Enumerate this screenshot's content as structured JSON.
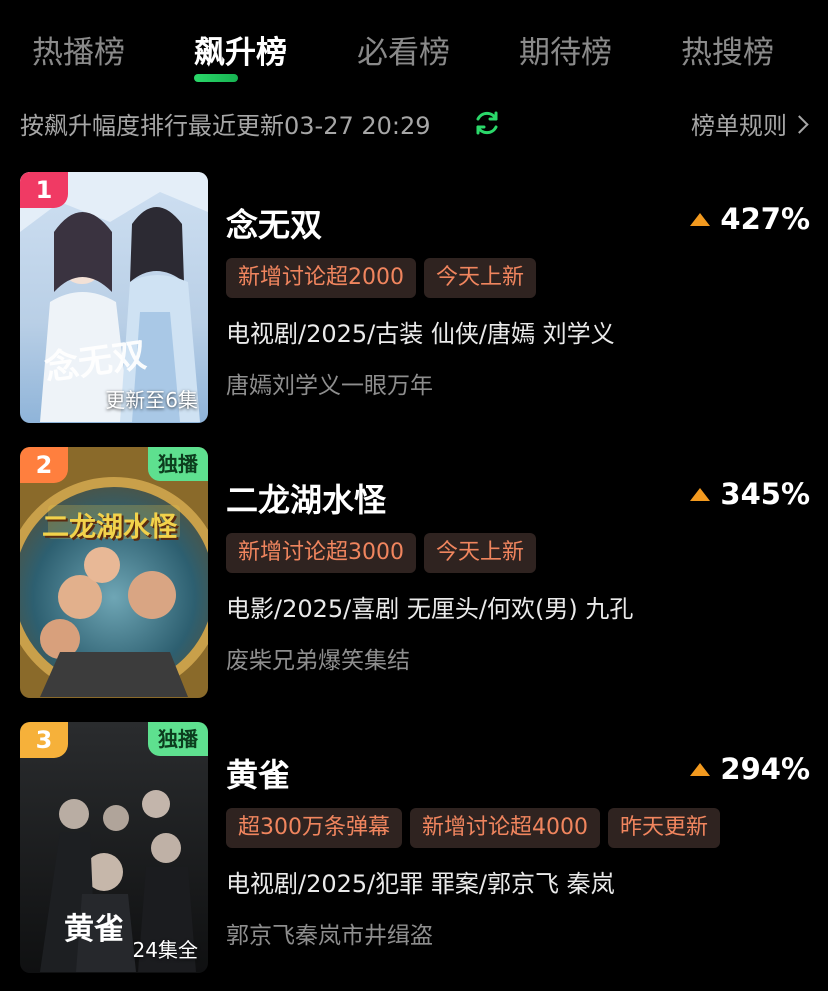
{
  "tabs": [
    {
      "label": "热播榜",
      "active": false
    },
    {
      "label": "飙升榜",
      "active": true
    },
    {
      "label": "必看榜",
      "active": false
    },
    {
      "label": "期待榜",
      "active": false
    },
    {
      "label": "热搜榜",
      "active": false
    }
  ],
  "subheader": {
    "sort_text": "按飙升幅度排行最近更新03-27 20:29",
    "refresh_icon": "refresh-icon",
    "rules_label": "榜单规则"
  },
  "colors": {
    "accent_green": "#2bd86a",
    "trend_up": "#f39a1f",
    "tag_text": "#f0855e",
    "rank1": "#f03a64",
    "rank2": "#ff7f3e",
    "rank3": "#f6b13a"
  },
  "items": [
    {
      "rank": "1",
      "title": "念无双",
      "trend": "427%",
      "tags": [
        "新增讨论超2000",
        "今天上新"
      ],
      "meta": "电视剧/2025/古装 仙侠/唐嫣 刘学义",
      "desc": "唐嫣刘学义一眼万年",
      "poster": {
        "badge": "",
        "caption": "更新至6集",
        "title": "念无双"
      }
    },
    {
      "rank": "2",
      "title": "二龙湖水怪",
      "trend": "345%",
      "tags": [
        "新增讨论超3000",
        "今天上新"
      ],
      "meta": "电影/2025/喜剧 无厘头/何欢(男) 九孔",
      "desc": "废柴兄弟爆笑集结",
      "poster": {
        "badge": "独播",
        "caption": "",
        "title": "二龙湖水怪"
      }
    },
    {
      "rank": "3",
      "title": "黄雀",
      "trend": "294%",
      "tags": [
        "超300万条弹幕",
        "新增讨论超4000",
        "昨天更新"
      ],
      "meta": "电视剧/2025/犯罪 罪案/郭京飞 秦岚",
      "desc": "郭京飞秦岚市井缉盗",
      "poster": {
        "badge": "独播",
        "caption": "24集全",
        "title": "黄雀"
      }
    }
  ]
}
